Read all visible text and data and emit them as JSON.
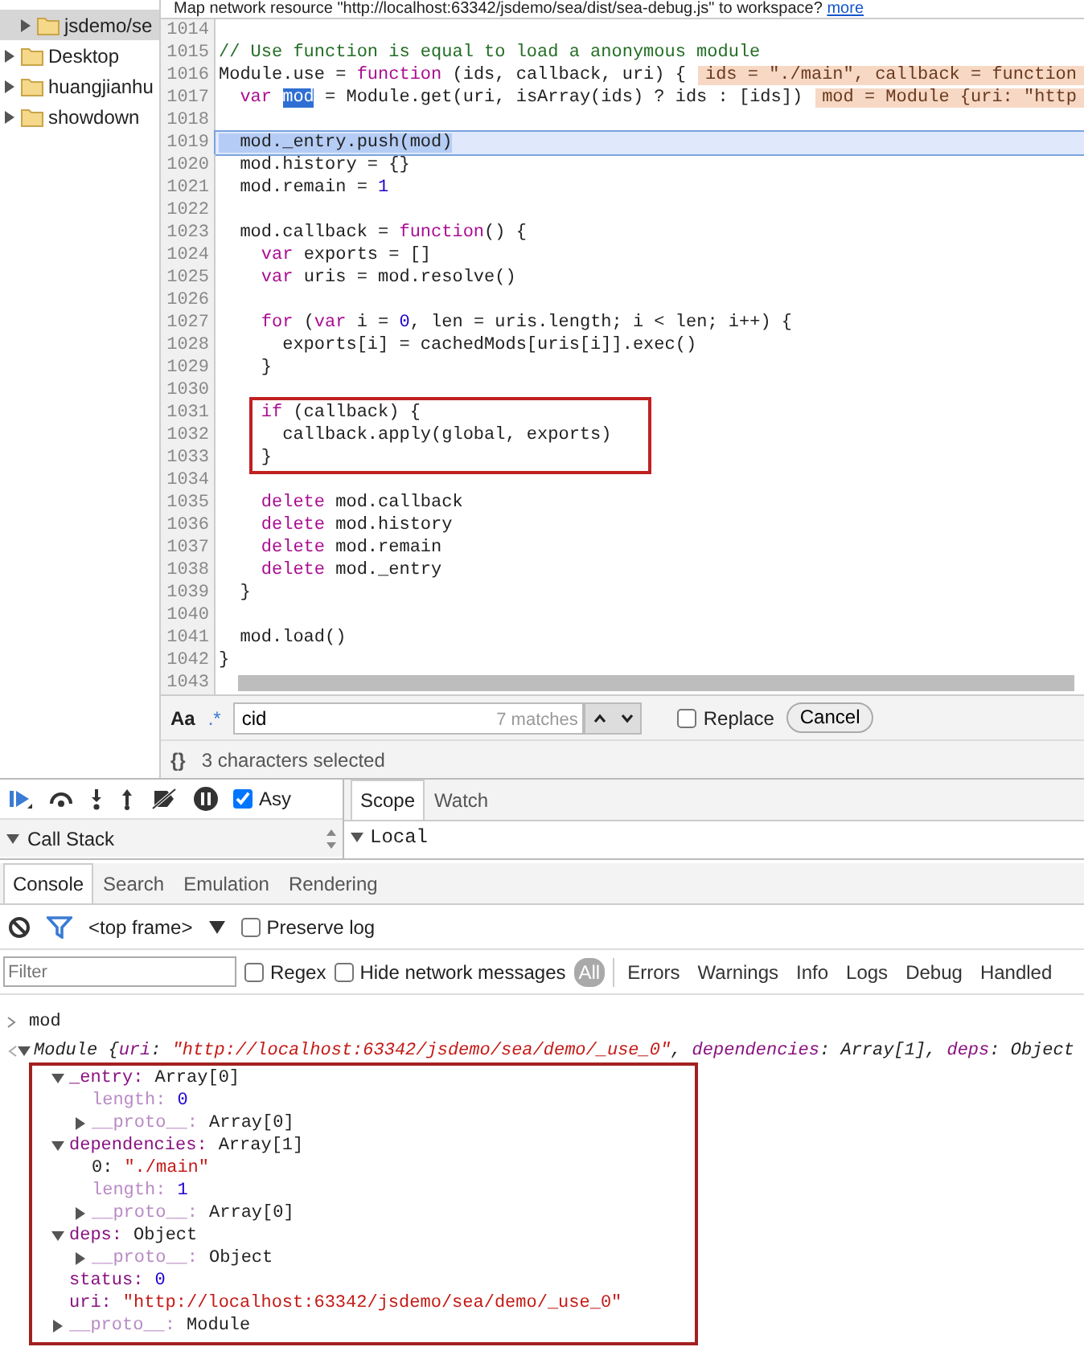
{
  "info_bar": {
    "text": "Map network resource \"http://localhost:63342/jsdemo/sea/dist/sea-debug.js\" to workspace?",
    "link": "more"
  },
  "navigator": {
    "items": [
      {
        "label": "jsdemo/se",
        "selected": true,
        "expanded": false
      },
      {
        "label": "Desktop",
        "selected": false,
        "expanded": false
      },
      {
        "label": "huangjianhu",
        "selected": false,
        "expanded": false
      },
      {
        "label": "showdown",
        "selected": false,
        "expanded": false
      }
    ]
  },
  "editor": {
    "lines": [
      {
        "n": "1014"
      },
      {
        "n": "1015",
        "segs": [
          {
            "kind": "comment",
            "text": "// Use function is equal to load a anonymous module"
          }
        ]
      },
      {
        "n": "1016",
        "segs": [
          {
            "kind": "plain",
            "text": "Module.use = "
          },
          {
            "kind": "keyword",
            "text": "function"
          },
          {
            "kind": "plain",
            "text": " (ids, callback, uri) {"
          }
        ],
        "inline_value": "ids = \"./main\", callback = function"
      },
      {
        "n": "1017",
        "segs": [
          {
            "kind": "keyword",
            "text": "  var "
          },
          {
            "kind": "match",
            "text": "mod"
          },
          {
            "kind": "plain",
            "text": " = Module.get(uri, isArray(ids) ? ids : [ids])"
          }
        ],
        "inline_value": "mod = Module {uri: \"http"
      },
      {
        "n": "1018"
      },
      {
        "n": "1019",
        "segs": [
          {
            "kind": "selection",
            "text": "  mod._entry.push(mod)"
          }
        ],
        "current": true
      },
      {
        "n": "1020",
        "segs": [
          {
            "kind": "plain",
            "text": "  mod.history = {}"
          }
        ]
      },
      {
        "n": "1021",
        "segs": [
          {
            "kind": "plain",
            "text": "  mod.remain = "
          },
          {
            "kind": "number",
            "text": "1"
          }
        ]
      },
      {
        "n": "1022"
      },
      {
        "n": "1023",
        "segs": [
          {
            "kind": "plain",
            "text": "  mod.callback = "
          },
          {
            "kind": "keyword",
            "text": "function"
          },
          {
            "kind": "plain",
            "text": "() {"
          }
        ]
      },
      {
        "n": "1024",
        "segs": [
          {
            "kind": "keyword",
            "text": "    var"
          },
          {
            "kind": "plain",
            "text": " exports = []"
          }
        ]
      },
      {
        "n": "1025",
        "segs": [
          {
            "kind": "keyword",
            "text": "    var"
          },
          {
            "kind": "plain",
            "text": " uris = mod.resolve()"
          }
        ]
      },
      {
        "n": "1026"
      },
      {
        "n": "1027",
        "segs": [
          {
            "kind": "keyword",
            "text": "    for"
          },
          {
            "kind": "plain",
            "text": " ("
          },
          {
            "kind": "keyword",
            "text": "var"
          },
          {
            "kind": "plain",
            "text": " i = "
          },
          {
            "kind": "number",
            "text": "0"
          },
          {
            "kind": "plain",
            "text": ", len = uris.length; i < len; i++) {"
          }
        ]
      },
      {
        "n": "1028",
        "segs": [
          {
            "kind": "plain",
            "text": "      exports[i] = cachedMods[uris[i]].exec()"
          }
        ]
      },
      {
        "n": "1029",
        "segs": [
          {
            "kind": "plain",
            "text": "    }"
          }
        ]
      },
      {
        "n": "1030"
      },
      {
        "n": "1031",
        "segs": [
          {
            "kind": "keyword",
            "text": "    if"
          },
          {
            "kind": "plain",
            "text": " (callback) {"
          }
        ],
        "boxed": true
      },
      {
        "n": "1032",
        "segs": [
          {
            "kind": "plain",
            "text": "      callback.apply(global, exports)"
          }
        ],
        "boxed": true
      },
      {
        "n": "1033",
        "segs": [
          {
            "kind": "plain",
            "text": "    }"
          }
        ],
        "boxed": true
      },
      {
        "n": "1034"
      },
      {
        "n": "1035",
        "segs": [
          {
            "kind": "keyword",
            "text": "    delete"
          },
          {
            "kind": "plain",
            "text": " mod.callback"
          }
        ]
      },
      {
        "n": "1036",
        "segs": [
          {
            "kind": "keyword",
            "text": "    delete"
          },
          {
            "kind": "plain",
            "text": " mod.history"
          }
        ]
      },
      {
        "n": "1037",
        "segs": [
          {
            "kind": "keyword",
            "text": "    delete"
          },
          {
            "kind": "plain",
            "text": " mod.remain"
          }
        ]
      },
      {
        "n": "1038",
        "segs": [
          {
            "kind": "keyword",
            "text": "    delete"
          },
          {
            "kind": "plain",
            "text": " mod._entry"
          }
        ]
      },
      {
        "n": "1039",
        "segs": [
          {
            "kind": "plain",
            "text": "  }"
          }
        ]
      },
      {
        "n": "1040"
      },
      {
        "n": "1041",
        "segs": [
          {
            "kind": "plain",
            "text": "  mod.load()"
          }
        ]
      },
      {
        "n": "1042",
        "segs": [
          {
            "kind": "plain",
            "text": "}"
          }
        ]
      },
      {
        "n": "1043",
        "scrollbar": true
      }
    ]
  },
  "search_bar": {
    "case_label": "Aa",
    "regex_label": ".*",
    "query": "cid",
    "match_count": "7 matches",
    "replace": {
      "label": "Replace",
      "checked": false
    },
    "cancel": "Cancel"
  },
  "status_bar": {
    "format_label": "{}",
    "text": "3 characters selected"
  },
  "debugger": {
    "async": {
      "label": "Asy",
      "checked": true
    },
    "sidebar_tabs": [
      {
        "label": "Scope",
        "selected": true
      },
      {
        "label": "Watch",
        "selected": false
      }
    ],
    "call_stack": {
      "label": "Call Stack",
      "expanded": true
    },
    "scope": {
      "label": "Local",
      "expanded": true
    }
  },
  "console": {
    "tabs": [
      {
        "label": "Console",
        "selected": true
      },
      {
        "label": "Search",
        "selected": false
      },
      {
        "label": "Emulation",
        "selected": false
      },
      {
        "label": "Rendering",
        "selected": false
      }
    ],
    "frame": "<top frame>",
    "preserve_log": {
      "label": "Preserve log",
      "checked": false
    },
    "filter": {
      "placeholder": "Filter"
    },
    "regex": {
      "label": "Regex",
      "checked": false
    },
    "hide_network": {
      "label": "Hide network messages",
      "checked": false
    },
    "levels": [
      {
        "label": "All",
        "selected": true
      },
      {
        "label": "Errors",
        "selected": false
      },
      {
        "label": "Warnings",
        "selected": false
      },
      {
        "label": "Info",
        "selected": false
      },
      {
        "label": "Logs",
        "selected": false
      },
      {
        "label": "Debug",
        "selected": false
      },
      {
        "label": "Handled",
        "selected": false
      }
    ],
    "input": "mod",
    "result": {
      "segs": [
        {
          "kind": "plain",
          "text": "Module {"
        },
        {
          "kind": "key",
          "text": "uri"
        },
        {
          "kind": "plain",
          "text": ": "
        },
        {
          "kind": "string",
          "text": "\"http://localhost:63342/jsdemo/sea/demo/_use_0\""
        },
        {
          "kind": "plain",
          "text": ", "
        },
        {
          "kind": "key",
          "text": "dependencies"
        },
        {
          "kind": "plain",
          "text": ": Array[1], "
        },
        {
          "kind": "key",
          "text": "deps"
        },
        {
          "kind": "plain",
          "text": ": Object"
        }
      ],
      "expanded": true,
      "boxed": true,
      "children": [
        {
          "key": "_entry:",
          "value": "Array[0]",
          "kind": "plain",
          "faded": false,
          "expanded": true,
          "children": [
            {
              "key": "length:",
              "value": "0",
              "kind": "number",
              "faded": true
            },
            {
              "key": "__proto__:",
              "value": "Array[0]",
              "kind": "plain",
              "faded": true,
              "expanded": false
            }
          ]
        },
        {
          "key": "dependencies:",
          "value": "Array[1]",
          "kind": "plain",
          "faded": false,
          "expanded": true,
          "children": [
            {
              "key": "0:",
              "value": "\"./main\"",
              "kind": "string",
              "faded": false,
              "index": true
            },
            {
              "key": "length:",
              "value": "1",
              "kind": "number",
              "faded": true
            },
            {
              "key": "__proto__:",
              "value": "Array[0]",
              "kind": "plain",
              "faded": true,
              "expanded": false
            }
          ]
        },
        {
          "key": "deps:",
          "value": "Object",
          "kind": "plain",
          "faded": false,
          "expanded": true,
          "children": [
            {
              "key": "__proto__:",
              "value": "Object",
              "kind": "plain",
              "faded": true,
              "expanded": false
            }
          ]
        },
        {
          "key": "status:",
          "value": "0",
          "kind": "number",
          "faded": false
        },
        {
          "key": "uri:",
          "value": "\"http://localhost:63342/jsdemo/sea/demo/_use_0\"",
          "kind": "string",
          "faded": false
        },
        {
          "key": "__proto__:",
          "value": "Module",
          "kind": "plain",
          "faded": true,
          "expanded": false
        }
      ]
    }
  }
}
